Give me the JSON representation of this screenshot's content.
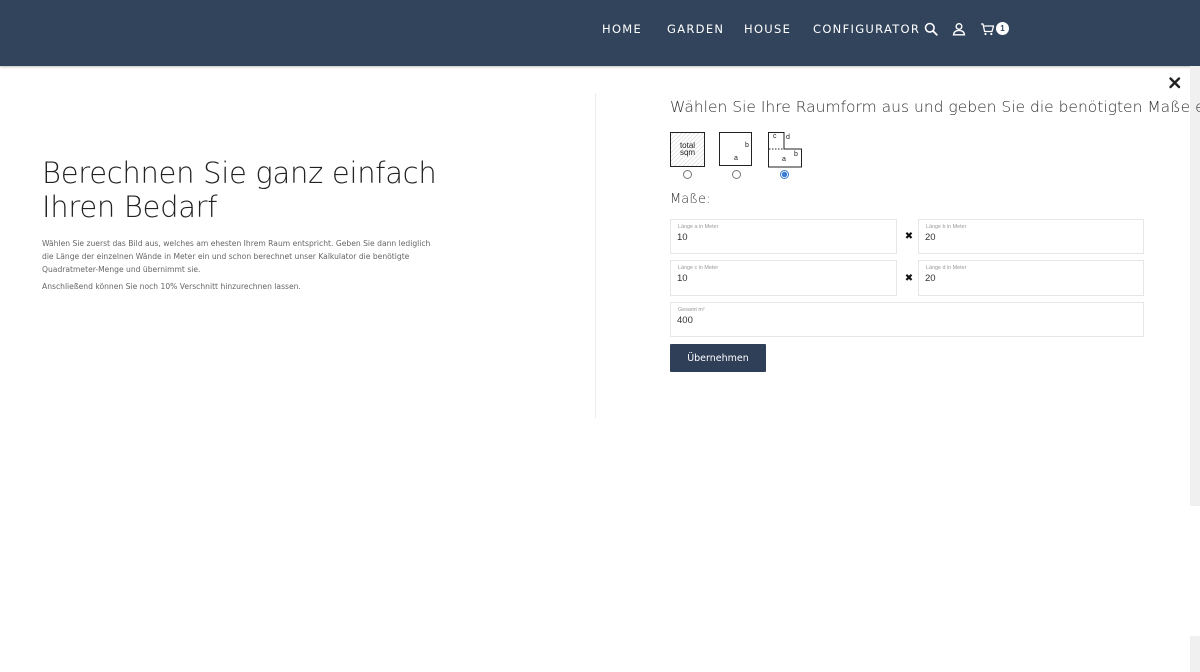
{
  "nav": {
    "items": [
      "HOME",
      "GARDEN",
      "HOUSE",
      "CONFIGURATOR"
    ],
    "cart_count": "1",
    "icons": [
      "search-icon",
      "user-icon",
      "cart-icon"
    ]
  },
  "left": {
    "title": "Berechnen Sie ganz einfach Ihren Bedarf",
    "paragraph1": "Wählen Sie zuerst das Bild aus, welches am ehesten Ihrem Raum entspricht. Geben Sie dann lediglich die Länge der einzelnen Wände in Meter ein und schon berechnet unser Kalkulator die benötigte Quadratmeter-Menge und übernimmt sie.",
    "paragraph2": "Anschließend können Sie noch 10% Verschnitt hinzurechnen lassen."
  },
  "right": {
    "title": "Wählen Sie Ihre Raumform aus und geben Sie die benötigten Maße ein.",
    "shapes": [
      {
        "label_line1": "total",
        "label_line2": "sqm",
        "selected": false
      },
      {
        "labels": [
          "b",
          "a"
        ],
        "selected": false
      },
      {
        "labels": [
          "c",
          "d",
          "a",
          "b"
        ],
        "selected": true
      }
    ],
    "masse_label": "Maße:",
    "fields": {
      "a": {
        "label": "Länge a in Meter",
        "value": "10"
      },
      "b": {
        "label": "Länge b in Meter",
        "value": "20"
      },
      "c": {
        "label": "Länge c in Meter",
        "value": "10"
      },
      "d": {
        "label": "Länge d in Meter",
        "value": "20"
      },
      "total": {
        "label": "Gesamt m²",
        "value": "400"
      }
    },
    "times_symbol": "✖",
    "submit_label": "Übernehmen"
  },
  "colors": {
    "header_bg": "#32445c",
    "button_bg": "#2f3f58",
    "radio_accent": "#3a7bd5"
  },
  "close_icon": "close-icon"
}
